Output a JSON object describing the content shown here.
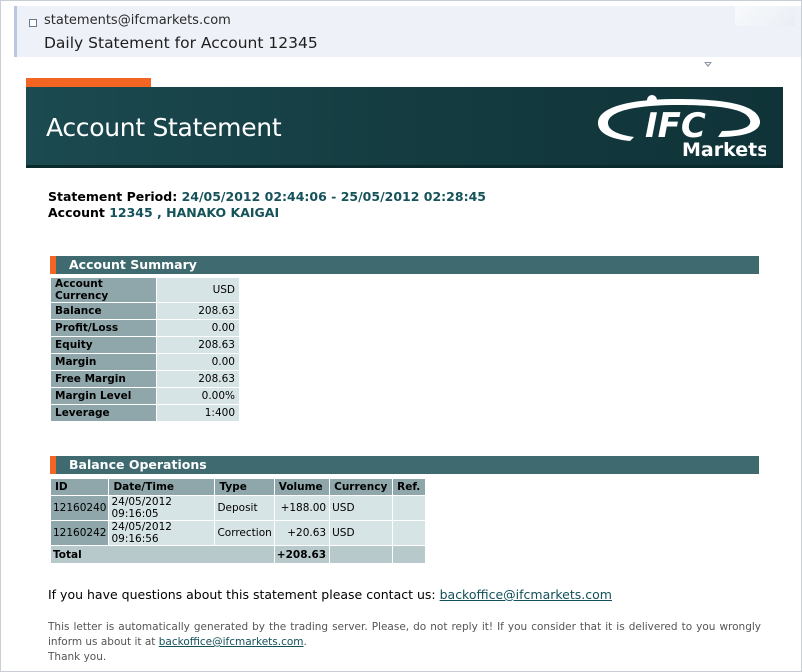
{
  "mail": {
    "sender": "statements@ifcmarkets.com",
    "subject": "Daily Statement for Account 12345"
  },
  "banner": {
    "title": "Account Statement",
    "logo_text": "IFC",
    "logo_sub": "Markets"
  },
  "statement": {
    "period_label": "Statement Period:",
    "period_value": "24/05/2012 02:44:06 - 25/05/2012 02:28:45",
    "account_label": "Account",
    "account_value": "12345 , HANAKO KAIGAI"
  },
  "summary": {
    "title": "Account Summary",
    "rows": [
      {
        "label": "Account Currency",
        "value": "USD"
      },
      {
        "label": "Balance",
        "value": "208.63"
      },
      {
        "label": "Profit/Loss",
        "value": "0.00"
      },
      {
        "label": "Equity",
        "value": "208.63"
      },
      {
        "label": "Margin",
        "value": "0.00"
      },
      {
        "label": "Free Margin",
        "value": "208.63"
      },
      {
        "label": "Margin Level",
        "value": "0.00%"
      },
      {
        "label": "Leverage",
        "value": "1:400"
      }
    ]
  },
  "operations": {
    "title": "Balance Operations",
    "headers": [
      "ID",
      "Date/Time",
      "Type",
      "Volume",
      "Currency",
      "Ref."
    ],
    "rows": [
      {
        "id": "12160240",
        "datetime": "24/05/2012 09:16:05",
        "type": "Deposit",
        "volume": "+188.00",
        "currency": "USD",
        "ref": ""
      },
      {
        "id": "12160242",
        "datetime": "24/05/2012 09:16:56",
        "type": "Correction",
        "volume": "+20.63",
        "currency": "USD",
        "ref": ""
      }
    ],
    "total_label": "Total",
    "total_value": "+208.63"
  },
  "footer": {
    "contact_text": "If you have questions about this statement please contact us: ",
    "contact_email": "backoffice@ifcmarkets.com",
    "note_text": "This letter is automatically generated by the trading server. Please, do not reply it! If you consider that it is delivered to you wrongly inform us about it at ",
    "note_email": "backoffice@ifcmarkets.com",
    "note_end": ".",
    "thanks": "Thank you."
  },
  "colors": {
    "banner": "#143c41",
    "accent": "#f26522",
    "section_bar": "#3e6a70",
    "label_cell": "#8fa7aa",
    "value_cell": "#d7e4e6"
  }
}
